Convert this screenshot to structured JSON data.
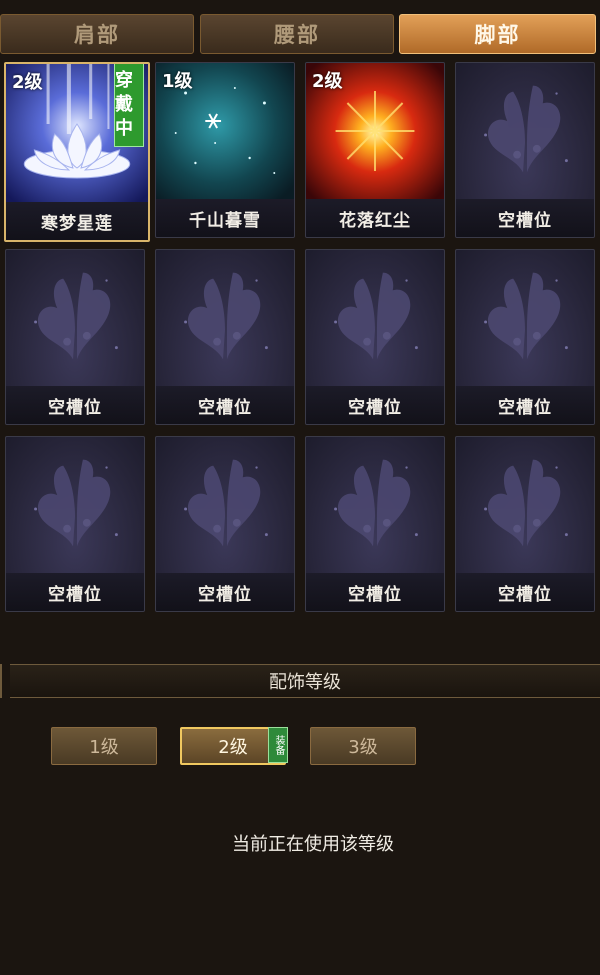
{
  "tabs": [
    {
      "label": "肩部",
      "active": false
    },
    {
      "label": "腰部",
      "active": false
    },
    {
      "label": "脚部",
      "active": true
    }
  ],
  "slots": [
    {
      "name": "寒梦星莲",
      "level": "2级",
      "badge": "穿戴中",
      "icon": "lotus-icon",
      "selected": true
    },
    {
      "name": "千山暮雪",
      "level": "1级",
      "icon": "snowflake-icon"
    },
    {
      "name": "花落红尘",
      "level": "2级",
      "icon": "red-burst-icon"
    },
    {
      "name": "空槽位",
      "icon": "butterfly-icon"
    },
    {
      "name": "空槽位",
      "icon": "butterfly-icon"
    },
    {
      "name": "空槽位",
      "icon": "butterfly-icon"
    },
    {
      "name": "空槽位",
      "icon": "butterfly-icon"
    },
    {
      "name": "空槽位",
      "icon": "butterfly-icon"
    },
    {
      "name": "空槽位",
      "icon": "butterfly-icon"
    },
    {
      "name": "空槽位",
      "icon": "butterfly-icon"
    },
    {
      "name": "空槽位",
      "icon": "butterfly-icon"
    },
    {
      "name": "空槽位",
      "icon": "butterfly-icon"
    }
  ],
  "section": {
    "title": "配饰等级"
  },
  "levels": [
    {
      "label": "1级",
      "active": false
    },
    {
      "label": "2级",
      "active": true,
      "tag": "装备"
    },
    {
      "label": "3级",
      "active": false
    }
  ],
  "status_text": "当前正在使用该等级",
  "colors": {
    "accent": "#e2a058",
    "badge_green": "#2e9a2e",
    "selected_border": "#d9b56a"
  }
}
